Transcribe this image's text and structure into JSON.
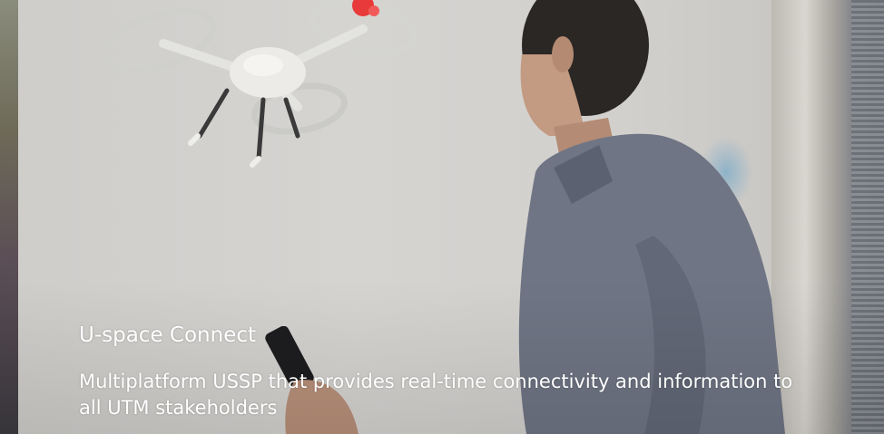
{
  "hero": {
    "title": "U-space Connect",
    "description": "Multiplatform USSP that provides real-time connectivity and information to all UTM stakeholders",
    "image_subject": "drone-pilot-photo"
  },
  "colors": {
    "text": "#ffffff",
    "drone_light": "#e83a3a",
    "shirt": "#6f7584"
  }
}
